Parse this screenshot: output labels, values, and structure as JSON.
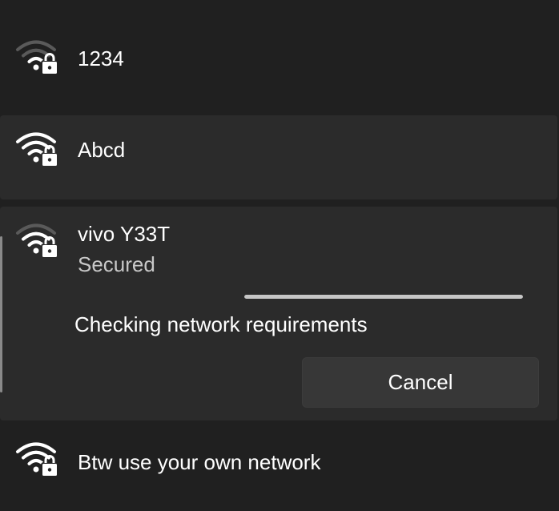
{
  "networks": [
    {
      "name": "1234",
      "status": "",
      "icon": "wifi-secured-icon"
    },
    {
      "name": "Abcd",
      "status": "",
      "icon": "wifi-secured-icon"
    },
    {
      "name": "vivo Y33T",
      "status": "Secured",
      "icon": "wifi-secured-icon"
    },
    {
      "name": "Btw use your own network",
      "status": "",
      "icon": "wifi-secured-icon"
    }
  ],
  "connecting": {
    "message": "Checking network requirements",
    "cancel_label": "Cancel",
    "progress": 1.0
  },
  "colors": {
    "background": "#202020",
    "card": "#2b2b2b",
    "button": "#373737",
    "progress": "#c6c6c6",
    "secondary_text": "#c8c8c8"
  }
}
